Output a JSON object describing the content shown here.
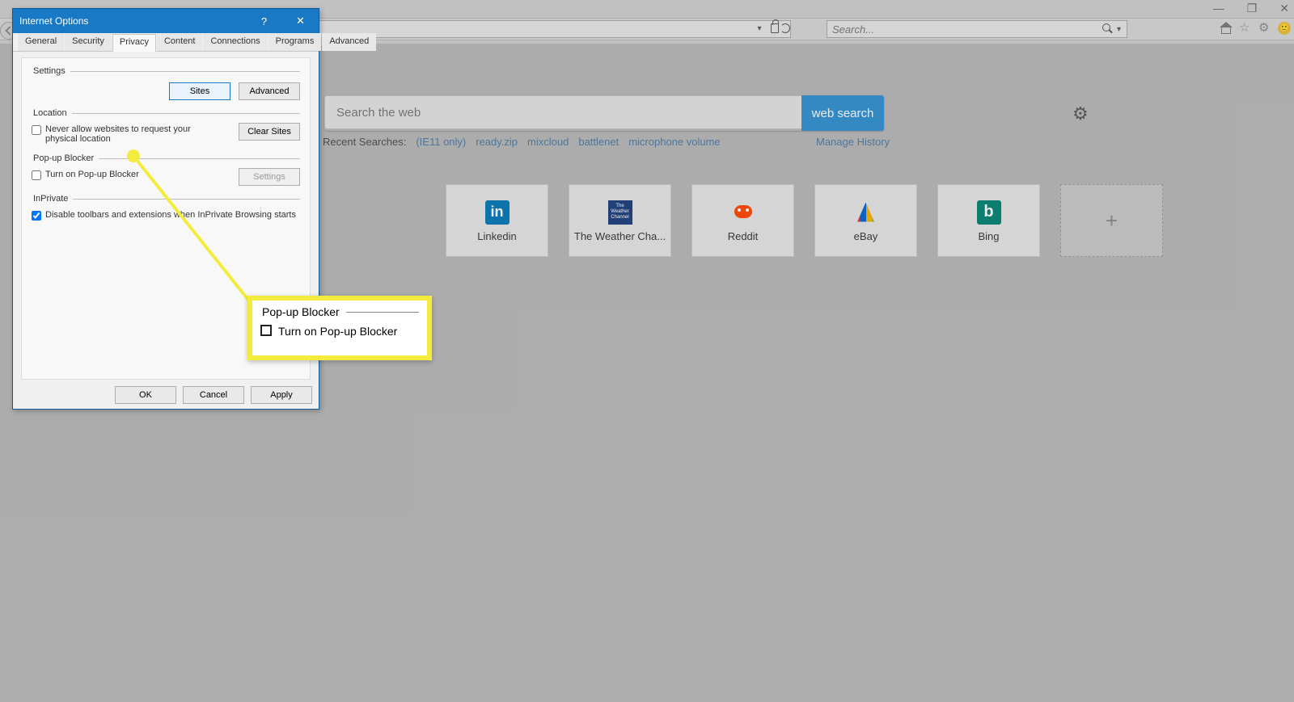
{
  "window": {
    "minimize": "—",
    "maximize": "❐",
    "close": "✕"
  },
  "chrome": {
    "search_placeholder": "Search...",
    "icons": {
      "home": "home",
      "star": "favorites",
      "gear": "tools",
      "face": "🙂"
    }
  },
  "newtab": {
    "search_placeholder": "Search the web",
    "search_button": "web search",
    "recent_label": "Recent Searches:",
    "recent": [
      "(IE11 only)",
      "ready.zip",
      "mixcloud",
      "battlenet",
      "microphone volume"
    ],
    "manage": "Manage History",
    "tiles": [
      {
        "label": "Linkedin",
        "icon": "linkedin"
      },
      {
        "label": "The Weather Cha...",
        "icon": "weather"
      },
      {
        "label": "Reddit",
        "icon": "reddit"
      },
      {
        "label": "eBay",
        "icon": "ebay"
      },
      {
        "label": "Bing",
        "icon": "bing"
      }
    ],
    "add_tile_label": "+"
  },
  "dialog": {
    "title": "Internet Options",
    "help": "?",
    "close": "✕",
    "tabs": [
      "General",
      "Security",
      "Privacy",
      "Content",
      "Connections",
      "Programs",
      "Advanced"
    ],
    "active_tab": "Privacy",
    "sections": {
      "settings": {
        "legend": "Settings",
        "sites_btn": "Sites",
        "advanced_btn": "Advanced"
      },
      "location": {
        "legend": "Location",
        "never_allow": "Never allow websites to request your physical location",
        "clear_btn": "Clear Sites"
      },
      "popup": {
        "legend": "Pop-up Blocker",
        "turn_on": "Turn on Pop-up Blocker",
        "settings_btn": "Settings"
      },
      "inprivate": {
        "legend": "InPrivate",
        "disable_ext": "Disable toolbars and extensions when InPrivate Browsing starts"
      }
    },
    "footer": {
      "ok": "OK",
      "cancel": "Cancel",
      "apply": "Apply"
    }
  },
  "callout": {
    "legend": "Pop-up Blocker",
    "turn_on": "Turn on Pop-up Blocker"
  }
}
